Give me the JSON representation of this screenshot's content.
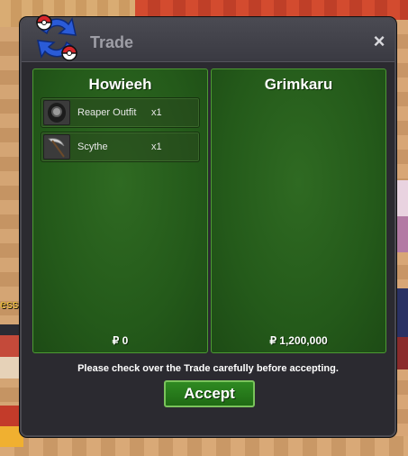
{
  "window": {
    "title": "Trade",
    "close_label": "×"
  },
  "left_trader": {
    "name": "Howieeh",
    "items": [
      {
        "name": "Reaper Outfit",
        "qty": "x1",
        "icon": "reaper-outfit-icon"
      },
      {
        "name": "Scythe",
        "qty": "x1",
        "icon": "scythe-icon"
      }
    ],
    "money": "₽ 0"
  },
  "right_trader": {
    "name": "Grimkaru",
    "items": [],
    "money": "₽ 1,200,000"
  },
  "notice": "Please check over the Trade carefully before accepting.",
  "accept_label": "Accept",
  "background": {
    "partial_label": "ess"
  },
  "colors": {
    "panel_green": "#245a1a",
    "accept_green": "#2f8a22",
    "window_dark": "#2b2a30"
  }
}
